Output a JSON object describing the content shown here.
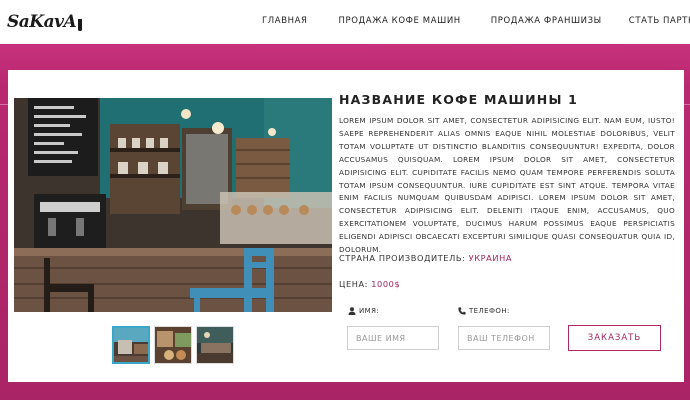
{
  "header": {
    "logo_text": "SaKavA",
    "nav": [
      {
        "label": "Главная"
      },
      {
        "label": "Продажа кофе машин"
      },
      {
        "label": "Продажа франшизы"
      },
      {
        "label": "Стать партнером"
      }
    ]
  },
  "product": {
    "title": "Название кофе машины 1",
    "description": "Lorem ipsum dolor sit amet, consectetur adipisicing elit. Nam eum, iusto! Saepe reprehenderit alias omnis eaque nihil molestiae doloribus, velit totam voluptate ut distinctio blanditiis consequuntur! Expedita, dolor accusamus quisquam. Lorem ipsum dolor sit amet, consectetur adipisicing elit. Cupiditate facilis nemo quam tempore perferendis soluta totam ipsum consequuntur. Iure cupiditate est sint atque. Tempora vitae enim facilis numquam quibusdam adipisci. Lorem ipsum dolor sit amet, consectetur adipisicing elit. Deleniti itaque enim, accusamus, quo exercitationem voluptate, ducimus harum possimus eaque perspiciatis eligendi adipisci obcaecati excepturi similique quasi consequatur quia id, dolorum.",
    "country_label": "Страна производитель:",
    "country_value": "Украина",
    "price_label": "Цена:",
    "price_value": "1000$"
  },
  "form": {
    "name_label": "Имя:",
    "name_placeholder": "Ваше имя",
    "phone_label": "Телефон:",
    "phone_placeholder": "Ваш телефон",
    "order_button": "Заказать"
  },
  "gallery": {
    "thumb_count": 3,
    "active_thumb": 1
  },
  "colors": {
    "accent": "#a3245f",
    "band": "#b82870",
    "thumb_active_border": "#3aa7c9"
  },
  "icons": {
    "name_field": "user-icon",
    "phone_field": "phone-icon"
  }
}
